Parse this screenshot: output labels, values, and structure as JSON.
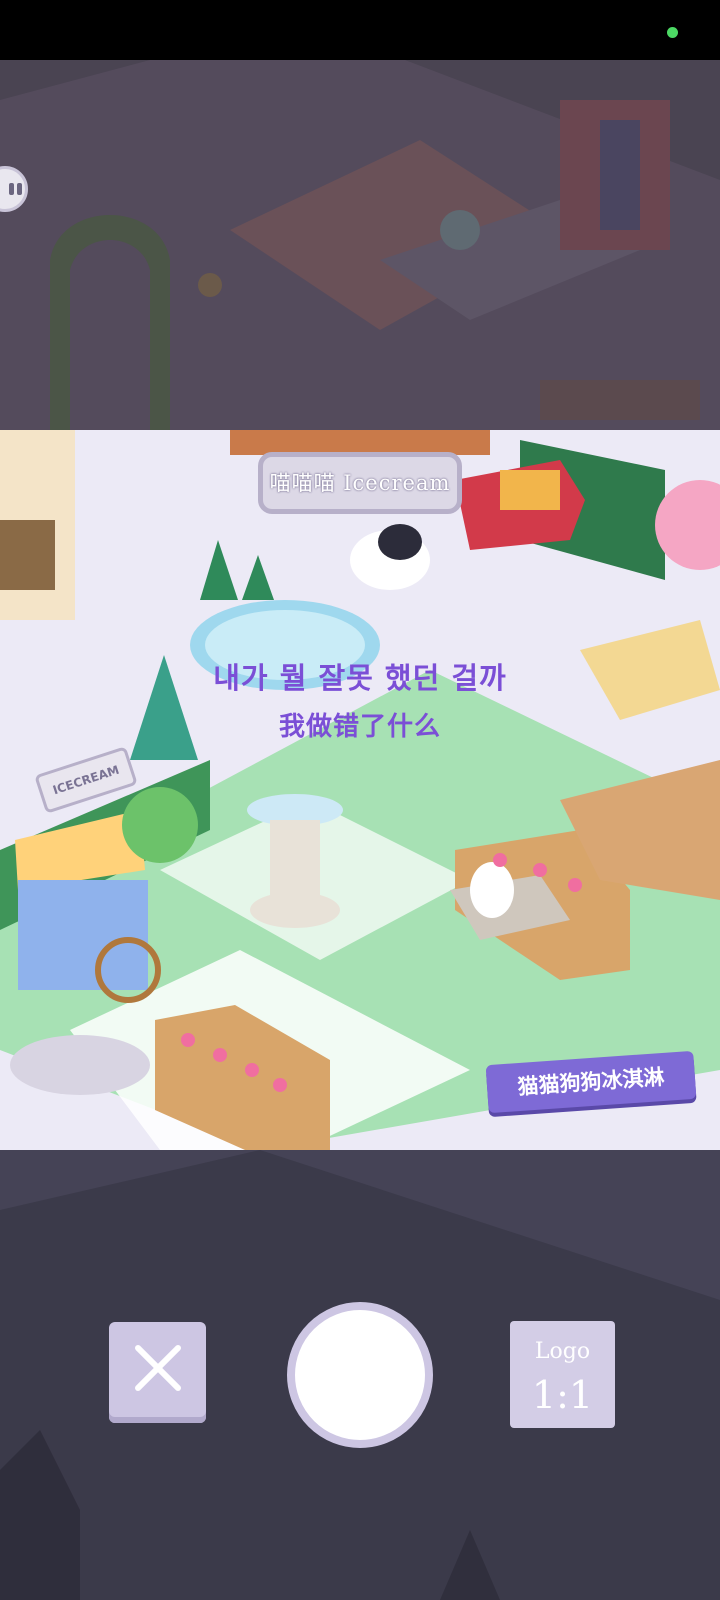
{
  "status_bar": {
    "indicator_color": "#4cd964"
  },
  "scene": {
    "shop_sign": "喵喵喵 Icecream",
    "cart_sign": "ICECREAM",
    "brand_logo": "猫猫狗狗冰淇淋"
  },
  "subtitles": {
    "korean": "내가 뭘 잘못 했던 걸까",
    "chinese": "我做错了什么"
  },
  "controls": {
    "close_icon": "close-icon",
    "shutter_icon": "shutter-circle",
    "ratio_logo": "Logo",
    "ratio_value": "1:1"
  },
  "colors": {
    "subtitle": "#7b4fd6",
    "button_lavender": "#cdc6e3",
    "background": "#3a3847"
  }
}
